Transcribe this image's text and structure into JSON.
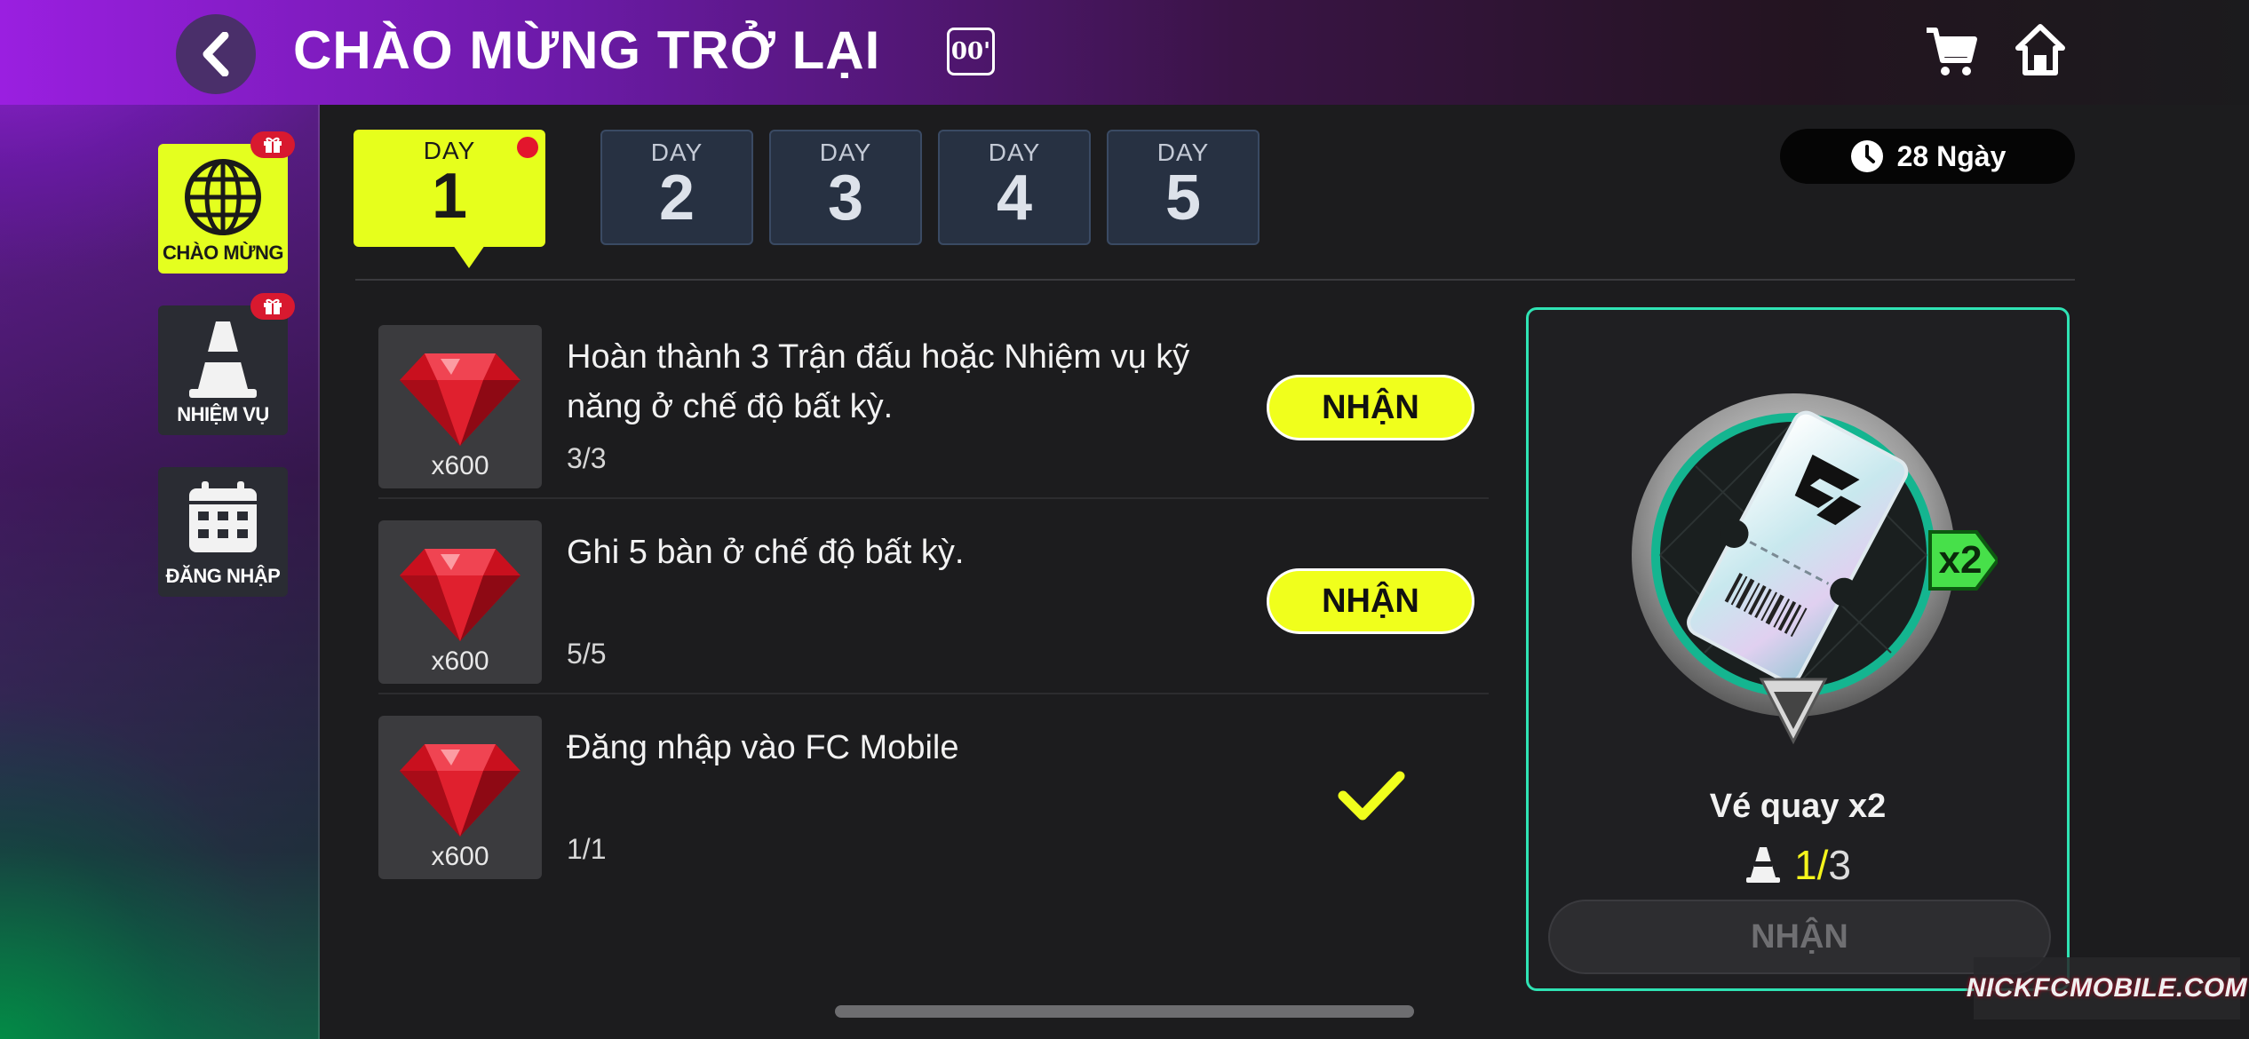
{
  "header": {
    "title": "CHÀO MỪNG TRỞ LẠI",
    "info_badge": "00'",
    "icons": [
      "back-chevron-icon",
      "cart-icon",
      "home-icon"
    ]
  },
  "sidebar": {
    "items": [
      {
        "label": "CHÀO MỪNG",
        "icon": "globe-icon",
        "active": true,
        "gift_badge": true
      },
      {
        "label": "NHIỆM VỤ",
        "icon": "cone-icon",
        "active": false,
        "gift_badge": true
      },
      {
        "label": "ĐĂNG NHẬP",
        "icon": "calendar-icon",
        "active": false,
        "gift_badge": false
      }
    ]
  },
  "days": [
    {
      "label": "DAY",
      "number": "1",
      "active": true,
      "notification": true
    },
    {
      "label": "DAY",
      "number": "2",
      "active": false
    },
    {
      "label": "DAY",
      "number": "3",
      "active": false
    },
    {
      "label": "DAY",
      "number": "4",
      "active": false
    },
    {
      "label": "DAY",
      "number": "5",
      "active": false
    }
  ],
  "timer": {
    "text": "28 Ngày",
    "icon": "clock-icon"
  },
  "tasks": [
    {
      "title": "Hoàn thành 3 Trận đấu hoặc Nhiệm vụ kỹ năng ở chế độ bất kỳ.",
      "progress": "3/3",
      "reward_qty": "x600",
      "reward_icon": "ruby-gem-icon",
      "action": "NHẬN"
    },
    {
      "title": "Ghi 5 bàn ở chế độ bất kỳ.",
      "progress": "5/5",
      "reward_qty": "x600",
      "reward_icon": "ruby-gem-icon",
      "action": "NHẬN"
    },
    {
      "title": "Đăng nhập vào FC Mobile",
      "progress": "1/1",
      "reward_qty": "x600",
      "reward_icon": "ruby-gem-icon",
      "action": "done"
    }
  ],
  "reward_card": {
    "name": "Vé quay x2",
    "multiplier": "x2",
    "count_current": "1/",
    "count_total": "3",
    "claim_label": "NHẬN",
    "accent": "#2fe3b4"
  },
  "watermark": "NICKFCMOBILE.COM",
  "colors": {
    "accent_yellow": "#e6ff1c",
    "badge_red": "#d8192f",
    "panel": "#1f1f22"
  }
}
